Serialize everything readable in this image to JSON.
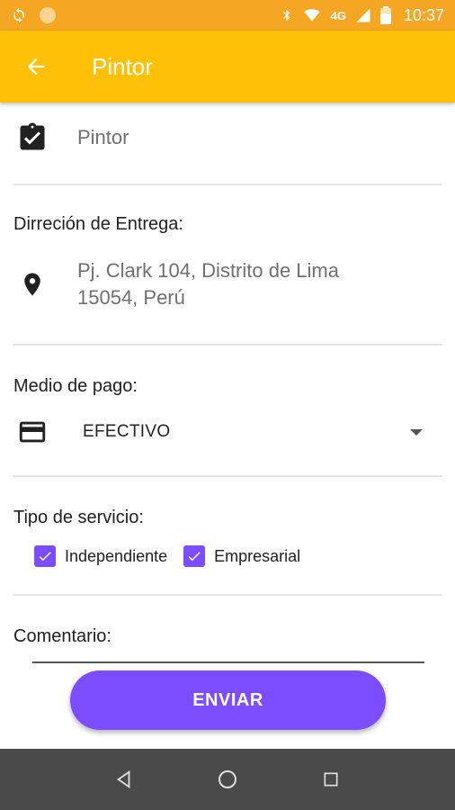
{
  "status_bar": {
    "network": "4G",
    "time": "10:37"
  },
  "app_bar": {
    "title": "Pintor"
  },
  "service": {
    "value": "Pintor"
  },
  "delivery": {
    "label": "Dirreción de Entrega:",
    "address_line1": "Pj. Clark 104, Distrito de Lima",
    "address_line2": "15054, Perú"
  },
  "payment": {
    "label": "Medio de pago:",
    "selected": "EFECTIVO"
  },
  "service_type": {
    "label": "Tipo de servicio:",
    "options": [
      {
        "label": "Independiente",
        "checked": true
      },
      {
        "label": "Empresarial",
        "checked": true
      }
    ]
  },
  "comment": {
    "label": "Comentario:",
    "value": ""
  },
  "actions": {
    "send_label": "ENVIAR"
  },
  "colors": {
    "status_bar": "#f5a623",
    "app_bar": "#ffc107",
    "accent": "#7c4dff",
    "nav_bar": "#4a4a4a"
  }
}
